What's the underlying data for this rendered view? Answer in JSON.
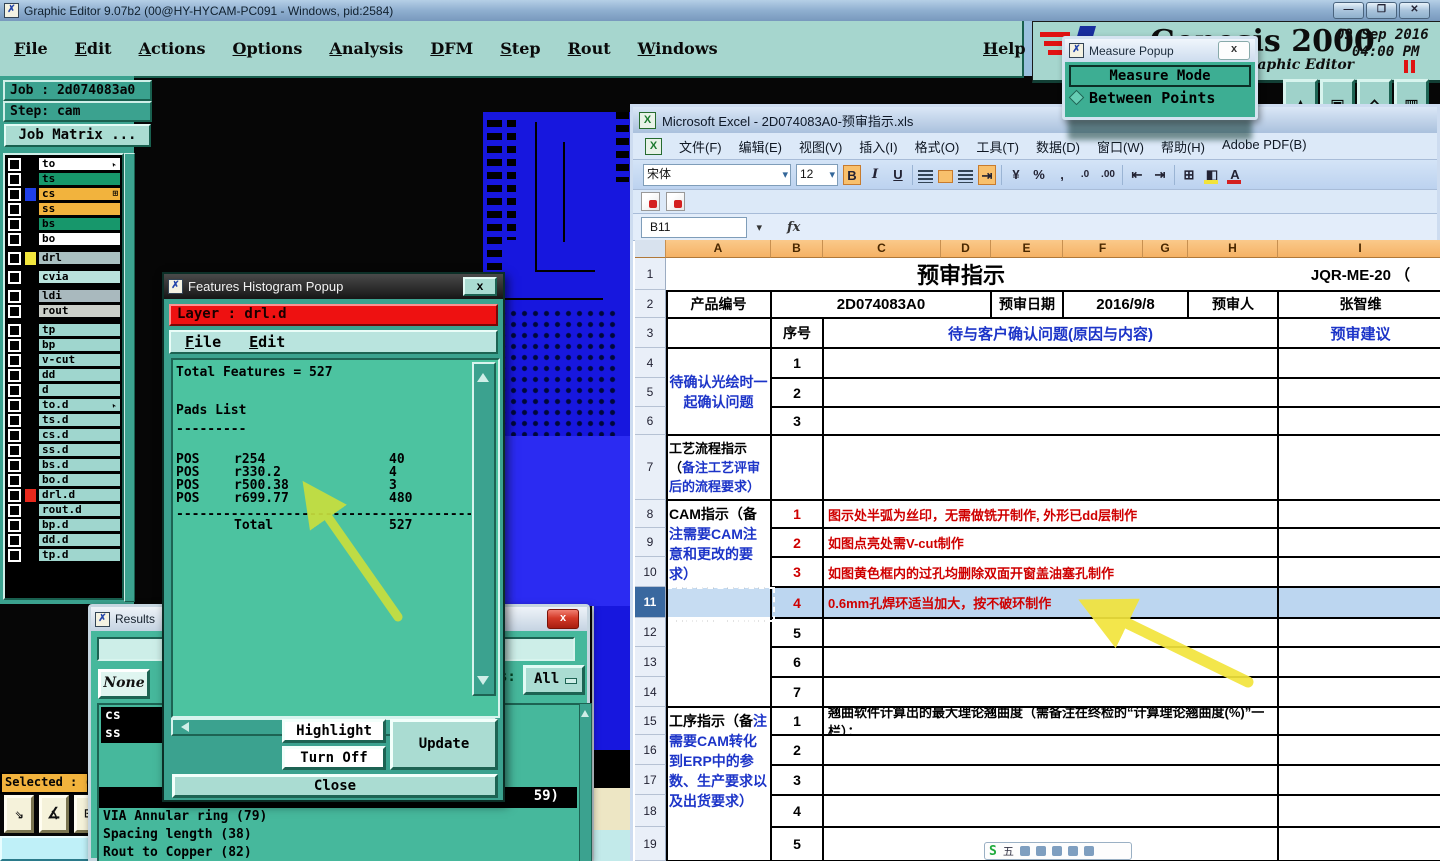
{
  "desktop": {
    "window_title": "Graphic Editor 9.07b2 (00@HY-HYCAM-PC091 - Windows, pid:2584)",
    "min_label": "—",
    "max_label": "❐",
    "close_label": "✕"
  },
  "genesis": {
    "menus": [
      "File",
      "Edit",
      "Actions",
      "Options",
      "Analysis",
      "DFM",
      "Step",
      "Rout",
      "Windows"
    ],
    "help_label": "Help",
    "brand": {
      "name": "Genesis 2000",
      "date": "09 Sep 2016",
      "time": "04:00 PM",
      "subtitle": "Graphic Editor"
    },
    "job": {
      "job_line": "Job : 2d074083a0",
      "step_line": "Step: cam",
      "matrix_button": "Job Matrix ..."
    },
    "layer_groups": [
      {
        "items": [
          {
            "name": "to",
            "bar": "#ffffff",
            "chip": "#000000",
            "marker": "cursor"
          },
          {
            "name": "ts",
            "bar": "#17976b",
            "chip": "#000000",
            "marker": ""
          },
          {
            "name": "cs",
            "bar": "#f2b33d",
            "chip": "#1f3fe8",
            "marker": "grid"
          },
          {
            "name": "ss",
            "bar": "#f2b33d",
            "chip": "#000000",
            "marker": ""
          },
          {
            "name": "bs",
            "bar": "#17976b",
            "chip": "#000000",
            "marker": ""
          },
          {
            "name": "bo",
            "bar": "#ffffff",
            "chip": "#000000",
            "marker": ""
          }
        ]
      },
      {
        "items": [
          {
            "name": "drl",
            "bar": "#a9bfc0",
            "chip": "#f2e63d",
            "marker": ""
          }
        ]
      },
      {
        "items": [
          {
            "name": "cvia",
            "bar": "#b9e2dc",
            "chip": "#000000",
            "marker": ""
          }
        ]
      },
      {
        "items": [
          {
            "name": "ldi",
            "bar": "#a9b9be",
            "chip": "#000000",
            "marker": ""
          },
          {
            "name": "rout",
            "bar": "#cbcfc9",
            "chip": "#000000",
            "marker": ""
          }
        ]
      },
      {
        "items": [
          {
            "name": "tp",
            "bar": "#9fd6ce",
            "chip": "#000000",
            "marker": ""
          },
          {
            "name": "bp",
            "bar": "#9fd6ce",
            "chip": "#000000",
            "marker": ""
          },
          {
            "name": "v-cut",
            "bar": "#9fd6ce",
            "chip": "#000000",
            "marker": ""
          },
          {
            "name": "dd",
            "bar": "#9fd6ce",
            "chip": "#000000",
            "marker": ""
          },
          {
            "name": "d",
            "bar": "#9fd6ce",
            "chip": "#000000",
            "marker": ""
          },
          {
            "name": "to.d",
            "bar": "#9fd6ce",
            "chip": "#000000",
            "marker": "cursor"
          },
          {
            "name": "ts.d",
            "bar": "#9fd6ce",
            "chip": "#000000",
            "marker": ""
          },
          {
            "name": "cs.d",
            "bar": "#9fd6ce",
            "chip": "#000000",
            "marker": ""
          },
          {
            "name": "ss.d",
            "bar": "#9fd6ce",
            "chip": "#000000",
            "marker": ""
          },
          {
            "name": "bs.d",
            "bar": "#9fd6ce",
            "chip": "#000000",
            "marker": ""
          },
          {
            "name": "bo.d",
            "bar": "#9fd6ce",
            "chip": "#000000",
            "marker": ""
          },
          {
            "name": "drl.d",
            "bar": "#9fd6ce",
            "chip": "#e8291d",
            "marker": ""
          },
          {
            "name": "rout.d",
            "bar": "#9fd6ce",
            "chip": "#000000",
            "marker": ""
          },
          {
            "name": "bp.d",
            "bar": "#9fd6ce",
            "chip": "#000000",
            "marker": ""
          },
          {
            "name": "dd.d",
            "bar": "#9fd6ce",
            "chip": "#000000",
            "marker": ""
          },
          {
            "name": "tp.d",
            "bar": "#9fd6ce",
            "chip": "#000000",
            "marker": ""
          }
        ]
      }
    ],
    "selected_text": "Selected : ("
  },
  "features_popup": {
    "title": "Features Histogram Popup",
    "close_label": "x",
    "layer_banner": "Layer :  drl.d",
    "menus": [
      "File",
      "Edit"
    ],
    "total_line": "Total Features = 527",
    "pads_header": "Pads List",
    "dash_short": "---------",
    "rows": [
      {
        "t": "POS",
        "n": "r254",
        "c": "40"
      },
      {
        "t": "POS",
        "n": "r330.2",
        "c": "4"
      },
      {
        "t": "POS",
        "n": "r500.38",
        "c": "3"
      },
      {
        "t": "POS",
        "n": "r699.77",
        "c": "480"
      }
    ],
    "dash_long": "--------------------------------------",
    "total_row": {
      "label": "Total",
      "value": "527"
    },
    "buttons": {
      "highlight": "Highlight",
      "turn_off": "Turn Off",
      "update": "Update",
      "close": "Close"
    }
  },
  "results_window": {
    "title": "Results",
    "close_label": "x",
    "none_button": "None",
    "left_items": [
      "cs",
      "ss"
    ],
    "filter_label": "s:",
    "filter_value": "All",
    "selected_partial": "59)",
    "items": [
      "VIA Annular ring (79)",
      "Spacing length (38)",
      "Rout to Copper (82)"
    ]
  },
  "measure_popup": {
    "title": "Measure Popup",
    "close_label": "x",
    "mode_header": "Measure Mode",
    "option": "Between Points"
  },
  "excel": {
    "title": "Microsoft Excel - 2D074083A0-预审指示.xls",
    "menus": [
      "文件(F)",
      "编辑(E)",
      "视图(V)",
      "插入(I)",
      "格式(O)",
      "工具(T)",
      "数据(D)",
      "窗口(W)",
      "帮助(H)",
      "Adobe PDF(B)"
    ],
    "font_name": "宋体",
    "font_size": "12",
    "bold_label": "B",
    "italic_label": "I",
    "underline_label": "U",
    "percent_label": "%",
    "comma_label": ",",
    "incdec_label": ".0",
    "decdec_label": ".00",
    "fontcolor_label": "A",
    "name_box": "B11",
    "fx_label": "fx",
    "columns": [
      "A",
      "B",
      "C",
      "D",
      "E",
      "F",
      "G",
      "H",
      "I"
    ],
    "rows": [
      "1",
      "2",
      "3",
      "4",
      "5",
      "6",
      "7",
      "8",
      "9",
      "10",
      "11",
      "12",
      "13",
      "14",
      "15",
      "16",
      "17",
      "18",
      "19"
    ],
    "cells": {
      "title": "预审指示",
      "doc_code": "JQR-ME-20 （",
      "product_label": "产品编号",
      "product_code": "2D074083A0",
      "date_label": "预审日期",
      "date_value": "2016/9/8",
      "reviewer_label": "预审人",
      "reviewer_value": "张智维",
      "seq_label": "序号",
      "confirm_header": "待与客户确认问题(原因与内容)",
      "advice_header": "预审建议",
      "section_confirm": "待确认光绘时一起确认问题",
      "confirm_nums": [
        "1",
        "2",
        "3"
      ],
      "section_flow_black": "工艺流程指示（",
      "section_flow_blue": "备注工艺评审后的流程要求）",
      "section_cam_black": "CAM指示（备",
      "section_cam_blue": "注需要CAM注意和更改的要求）",
      "cam_rows": [
        {
          "n": "1",
          "text": "图示处半弧为丝印，无需做铣开制作, 外形已dd层制作"
        },
        {
          "n": "2",
          "text": "如图点亮处需V-cut制作"
        },
        {
          "n": "3",
          "text": "如图黄色框内的过孔均删除双面开窗盖油塞孔制作"
        },
        {
          "n": "4",
          "text": "0.6mm孔焊环适当加大，按不破环制作"
        },
        {
          "n": "5",
          "text": ""
        },
        {
          "n": "6",
          "text": ""
        },
        {
          "n": "7",
          "text": ""
        }
      ],
      "warp_row_num": "1",
      "warp_text": "翘曲软件计算出的最大理论翘曲度（需备注在终检的“计算理论翘曲度(%)”一栏）：",
      "section_proc_black": "工序指示（备",
      "section_proc_blue": "注需要CAM转化到ERP中的参数、生产要求以及出货要求）",
      "proc_nums": [
        "2",
        "3",
        "4",
        "5"
      ]
    }
  },
  "ime": {
    "brand": "S",
    "mode": "五"
  }
}
